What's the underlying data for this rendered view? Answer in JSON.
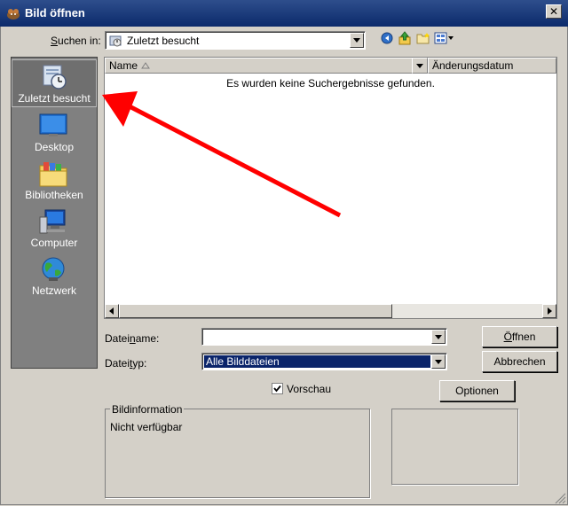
{
  "window": {
    "title": "Bild öffnen",
    "close_glyph": "✕"
  },
  "toolbar": {
    "look_in_label_prefix": "",
    "look_in_label_mnemonic": "S",
    "look_in_label_rest": "uchen in:",
    "look_in_value": "Zuletzt besucht"
  },
  "sidebar": {
    "items": [
      {
        "label": "Zuletzt besucht",
        "icon": "recent-places-icon"
      },
      {
        "label": "Desktop",
        "icon": "desktop-icon"
      },
      {
        "label": "Bibliotheken",
        "icon": "libraries-icon"
      },
      {
        "label": "Computer",
        "icon": "computer-icon"
      },
      {
        "label": "Netzwerk",
        "icon": "network-icon"
      }
    ]
  },
  "list": {
    "columns": [
      "Name",
      "Änderungsdatum"
    ],
    "empty_message": "Es wurden keine Suchergebnisse gefunden."
  },
  "form": {
    "filename_label_pre": "Datei",
    "filename_label_mnemonic": "n",
    "filename_label_post": "ame:",
    "filename_value": "",
    "filetype_label_pre": "Datei",
    "filetype_label_mnemonic": "t",
    "filetype_label_post": "yp:",
    "filetype_value": "Alle Bilddateien"
  },
  "buttons": {
    "open_mnemonic": "Ö",
    "open_rest": "ffnen",
    "cancel": "Abbrechen",
    "options": "Optionen"
  },
  "preview": {
    "label": "Vorschau",
    "checked": true
  },
  "image_info": {
    "legend": "Bildinformation",
    "value": "Nicht verfügbar"
  },
  "colors": {
    "selection": "#0a246a",
    "annotation_arrow": "#ff0000",
    "titlebar": "#0b2a6b"
  }
}
